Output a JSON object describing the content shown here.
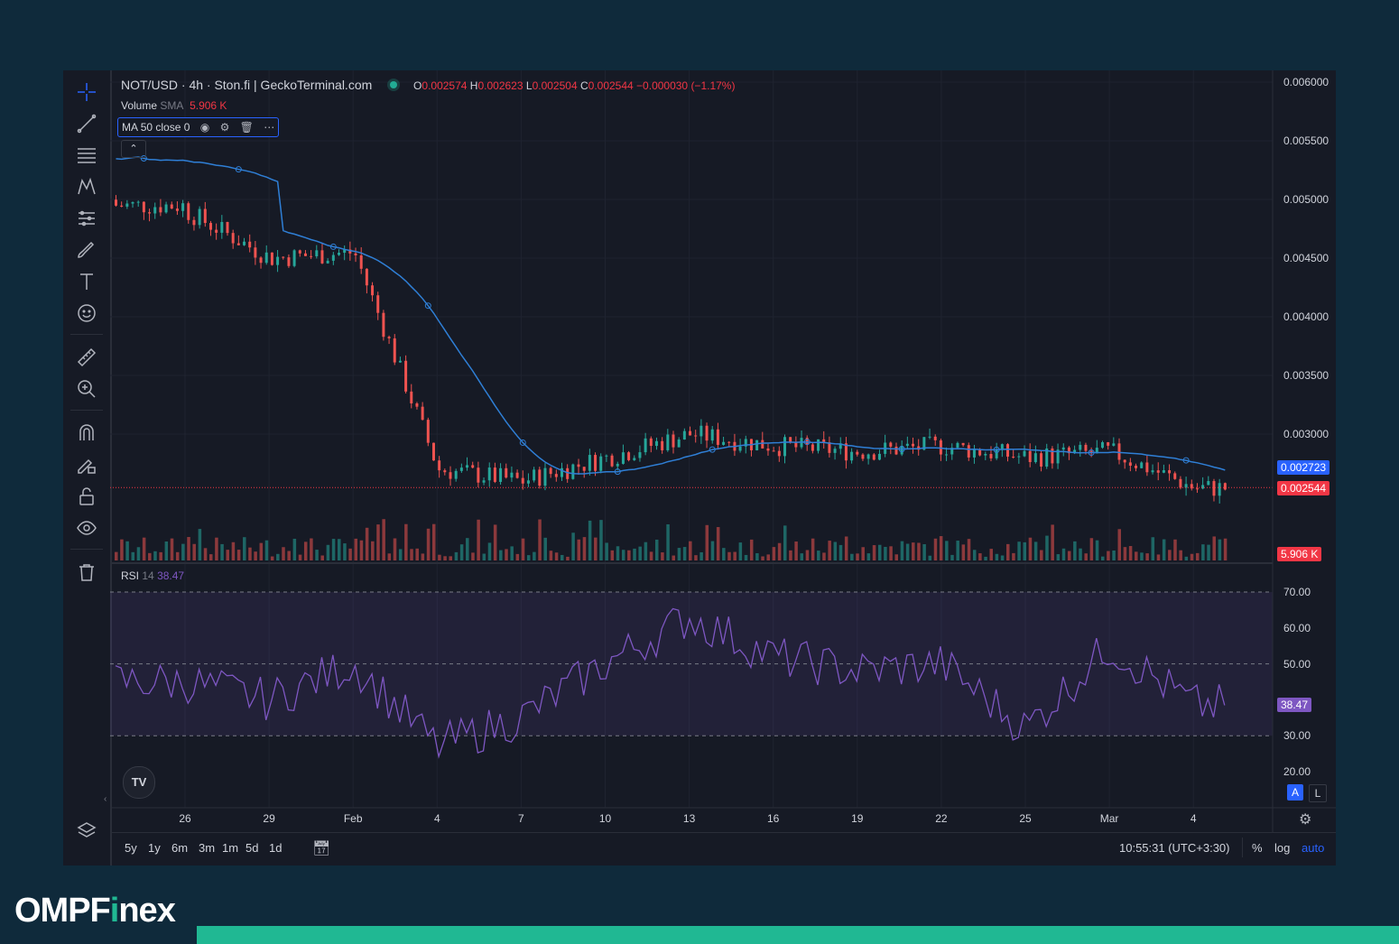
{
  "header": {
    "pair": "NOT/USD · 4h · Ston.fi | GeckoTerminal.com",
    "ohlc": {
      "o_label": "O",
      "o": "0.002574",
      "h_label": "H",
      "h": "0.002623",
      "l_label": "L",
      "l": "0.002504",
      "c_label": "C",
      "c": "0.002544",
      "change": "−0.000030 (−1.17%)"
    },
    "volume_label": "Volume",
    "volume_sma": "SMA",
    "volume_value": "5.906 K",
    "ma_label": "MA",
    "ma_params": "50 close 0",
    "rsi_label": "RSI",
    "rsi_params": "14",
    "rsi_value": "38.47"
  },
  "price_axis": {
    "ticks": [
      "0.006000",
      "0.005500",
      "0.005000",
      "0.004500",
      "0.004000",
      "0.003500",
      "0.003000"
    ],
    "ma_tag": "0.002723",
    "last_tag": "0.002544",
    "volume_tag": "5.906 K"
  },
  "rsi_axis": {
    "ticks": [
      "70.00",
      "60.00",
      "50.00",
      "30.00",
      "20.00"
    ],
    "value_tag": "38.47"
  },
  "x_axis": {
    "labels": [
      "26",
      "29",
      "Feb",
      "4",
      "7",
      "10",
      "13",
      "16",
      "19",
      "22",
      "25",
      "Mar",
      "4"
    ]
  },
  "bottom_bar": {
    "timeframes": [
      "5y",
      "1y",
      "6m",
      "3m",
      "1m",
      "5d",
      "1d"
    ],
    "clock": "10:55:31 (UTC+3:30)",
    "percent": "%",
    "log": "log",
    "auto": "auto"
  },
  "scale_buttons": {
    "a": "A",
    "l": "L"
  },
  "toolbar_icons": [
    "crosshair-icon",
    "trend-line-icon",
    "fib-icon",
    "pattern-icon",
    "prediction-icon",
    "brush-icon",
    "text-icon",
    "emoji-icon",
    "ruler-icon",
    "zoom-in-icon",
    "magnet-icon",
    "lock-drawing-icon",
    "lock-icon",
    "eye-icon",
    "trash-icon",
    "layers-icon"
  ],
  "brand": {
    "name_left": "OMPF",
    "name_i": "i",
    "name_right": "nex"
  },
  "colors": {
    "up": "#26a69a",
    "down": "#ef5350",
    "ma": "#2f7fd6",
    "rsi": "#7e57c2",
    "background": "#161a25",
    "brand_band": "#0f2a3b",
    "brand_green": "#20b893"
  },
  "chart_data": [
    {
      "type": "candlestick",
      "title": "NOT/USD · 4h · Ston.fi | GeckoTerminal.com",
      "x_ticks": [
        "26",
        "29",
        "Feb",
        "4",
        "7",
        "10",
        "13",
        "16",
        "19",
        "22",
        "25",
        "Mar",
        "4"
      ],
      "ylim": [
        0.0025,
        0.006
      ],
      "close_path": {
        "x": [
          "26",
          "29",
          "Feb",
          "4",
          "7",
          "10",
          "13",
          "16",
          "19",
          "22",
          "25",
          "Mar",
          "4"
        ],
        "y": [
          0.0049,
          0.0045,
          0.00455,
          0.0027,
          0.0026,
          0.0028,
          0.003,
          0.0029,
          0.00285,
          0.0029,
          0.0028,
          0.00285,
          0.00254
        ]
      },
      "last_close": 0.002544,
      "ma50_last": 0.002723
    },
    {
      "type": "bar",
      "name": "Volume",
      "sma_last": 5.906
    },
    {
      "type": "line",
      "name": "RSI",
      "params": "14",
      "ylim": [
        15,
        75
      ],
      "bands": [
        30,
        50,
        70
      ],
      "x": [
        "26",
        "29",
        "Feb",
        "4",
        "7",
        "10",
        "13",
        "16",
        "19",
        "22",
        "25",
        "Mar",
        "4"
      ],
      "y": [
        45,
        40,
        50,
        27,
        35,
        50,
        63,
        52,
        48,
        50,
        32,
        55,
        38.47
      ],
      "last": 38.47
    }
  ]
}
